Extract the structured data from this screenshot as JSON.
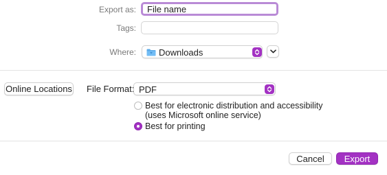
{
  "colors": {
    "accent": "#a332c3",
    "accent_dark": "#8f24b0"
  },
  "export_as": {
    "label": "Export as:",
    "value": "File name"
  },
  "tags": {
    "label": "Tags:",
    "value": ""
  },
  "where": {
    "label": "Where:",
    "value": "Downloads",
    "icon": "folder-icon"
  },
  "online_locations_label": "Online Locations",
  "file_format": {
    "label": "File Format:",
    "value": "PDF"
  },
  "options": [
    {
      "label": "Best for electronic distribution and accessibility",
      "sublabel": "(uses Microsoft online service)",
      "selected": false
    },
    {
      "label": "Best for printing",
      "selected": true
    }
  ],
  "buttons": {
    "cancel": "Cancel",
    "export": "Export"
  }
}
